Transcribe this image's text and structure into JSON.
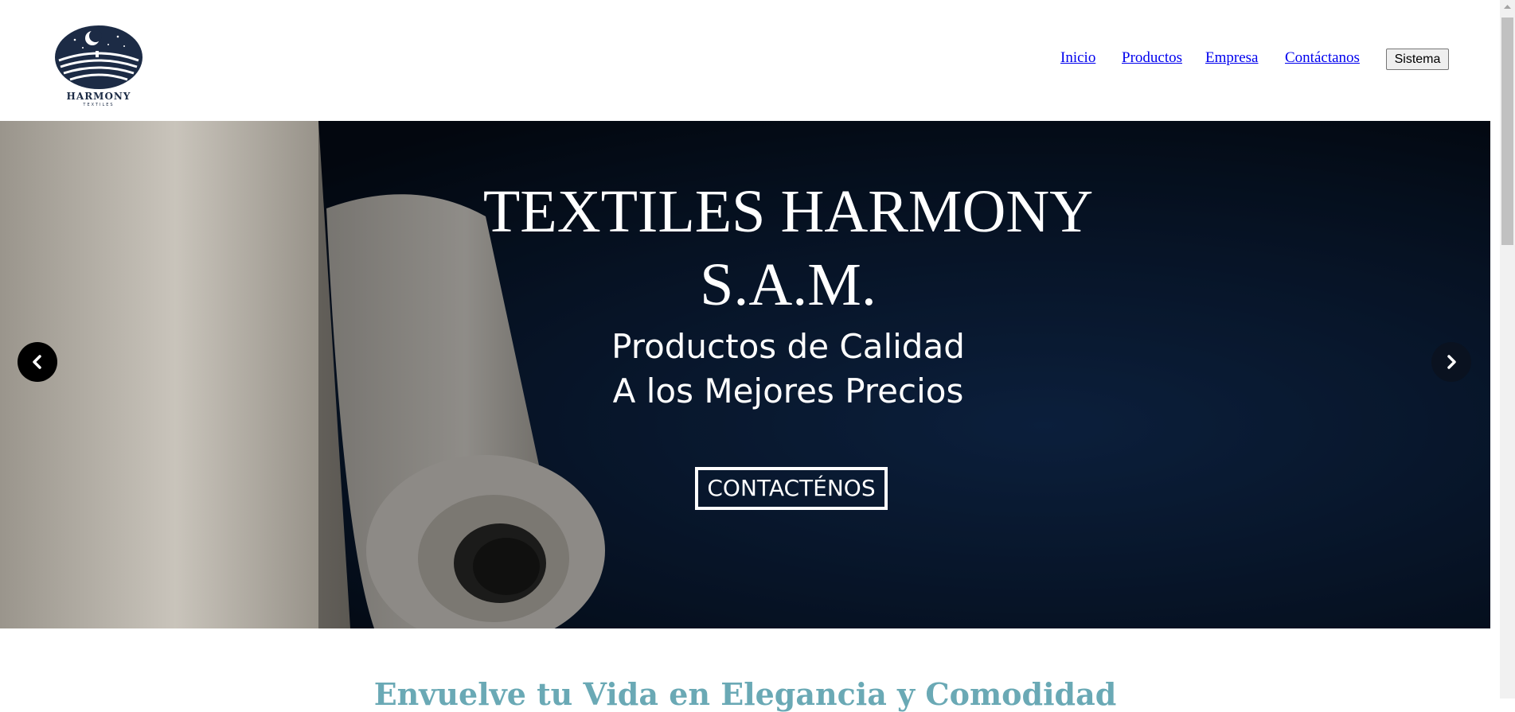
{
  "brand": {
    "name": "HARMONY",
    "tagline": "TEXTILES"
  },
  "nav": {
    "items": [
      "Inicio",
      "Productos",
      "Empresa",
      "Contáctanos"
    ],
    "system_button": "Sistema"
  },
  "hero": {
    "title_line1": "TEXTILES HARMONY",
    "title_line2": "S.A.M.",
    "subtitle_line1": "Productos de Calidad",
    "subtitle_line2": "A los Mejores Precios",
    "cta": "CONTACTÉNOS"
  },
  "section": {
    "title": "Envuelve tu Vida en Elegancia y Comodidad"
  },
  "colors": {
    "accent": "#6aa9b5",
    "link": "#0000ee",
    "logo_navy": "#1c2b45"
  },
  "icons": {
    "prev": "chevron-left-icon",
    "next": "chevron-right-icon"
  }
}
